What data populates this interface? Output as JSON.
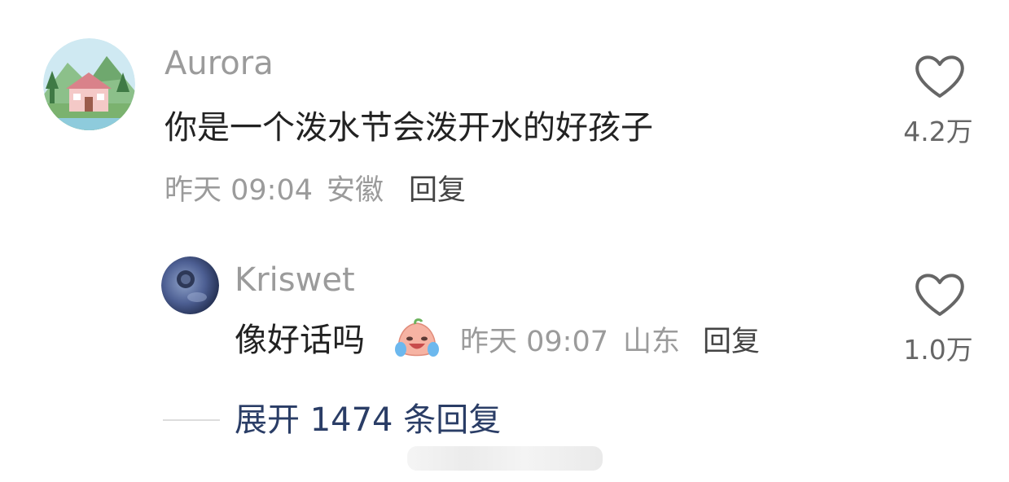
{
  "comments": [
    {
      "username": "Aurora",
      "text": "你是一个泼水节会泼开水的好孩子",
      "time": "昨天 09:04",
      "location": "安徽",
      "reply_label": "回复",
      "like_count": "4.2万",
      "avatar_icon": "cottage-landscape-avatar"
    }
  ],
  "replies": [
    {
      "username": "Kriswet",
      "text": "像好话吗",
      "emoji": "crying-laughing-peach-emoji",
      "time": "昨天 09:07",
      "location": "山东",
      "reply_label": "回复",
      "like_count": "1.0万",
      "avatar_icon": "blueberry-avatar"
    }
  ],
  "expand_replies_label": "展开 1474 条回复",
  "colors": {
    "username": "#9b9b9b",
    "text": "#222222",
    "meta": "#9b9b9b",
    "expand_link": "#2a3d66"
  }
}
